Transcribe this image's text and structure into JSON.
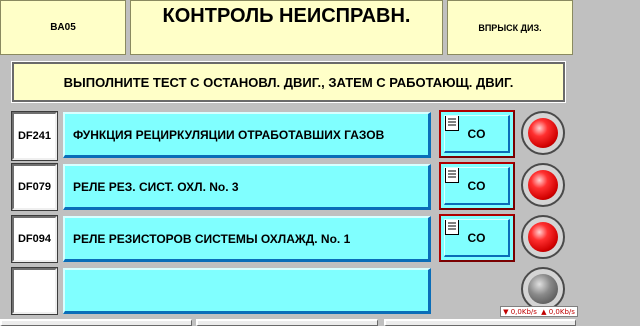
{
  "header": {
    "code": "BA05",
    "title": "КОНТРОЛЬ НЕИСПРАВН.",
    "mode": "ВПРЫСК ДИЗ."
  },
  "instruction": "ВЫПОЛНИТЕ ТЕСТ С ОСТАНОВЛ. ДВИГ., ЗАТЕМ С РАБОТАЮЩ. ДВИГ.",
  "faults": [
    {
      "code": "DF241",
      "label": "ФУНКЦИЯ РЕЦИРКУЛЯЦИИ ОТРАБОТАВШИХ ГАЗОВ",
      "status": "CO",
      "lamp": "red",
      "lamp_color": "#e00000"
    },
    {
      "code": "DF079",
      "label": "РЕЛЕ РЕЗ. СИСТ. ОХЛ. No. 3",
      "status": "CO",
      "lamp": "red",
      "lamp_color": "#e00000"
    },
    {
      "code": "DF094",
      "label": "РЕЛЕ РЕЗИСТОРОВ СИСТЕМЫ ОХЛАЖД. No. 1",
      "status": "CO",
      "lamp": "red",
      "lamp_color": "#e00000"
    },
    {
      "code": "",
      "label": "",
      "status": "",
      "lamp": "gray",
      "lamp_color": "#808080"
    }
  ],
  "net_stats": {
    "down": "0,0Kb/s",
    "up": "0,0Kb/s"
  },
  "colors": {
    "background": "#c0c0c0",
    "header_yellow": "#ffffc8",
    "fault_cyan": "#80ffff",
    "shadow_blue": "#0a6db8"
  }
}
